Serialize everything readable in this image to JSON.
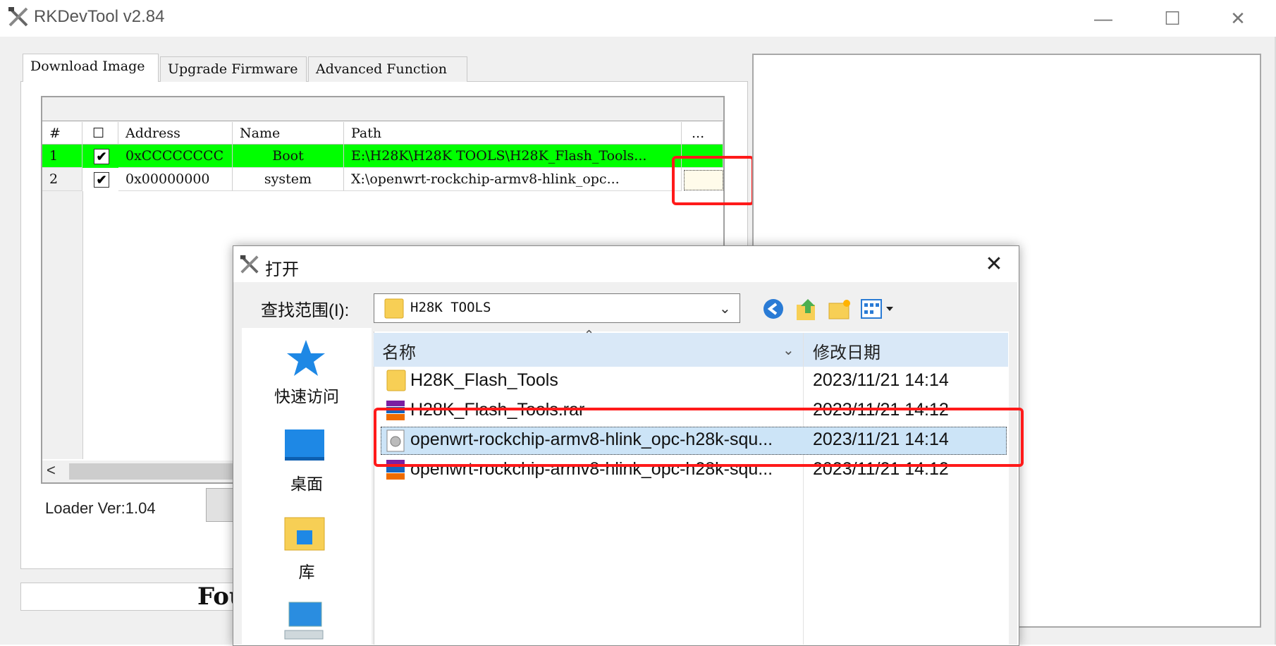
{
  "app": {
    "title": "RKDevTool v2.84",
    "minimize": "—",
    "maximize": "☐",
    "close": "✕"
  },
  "tabs": [
    "Download Image",
    "Upgrade Firmware",
    "Advanced Function"
  ],
  "grid": {
    "headers": [
      "#",
      "☐",
      "Address",
      "Name",
      "Path",
      "..."
    ],
    "rows": [
      {
        "num": "1",
        "checked": "✔",
        "address": "0xCCCCCCCC",
        "name": "Boot",
        "path": "E:\\H28K\\H28K TOOLS\\H28K_Flash_Tools..."
      },
      {
        "num": "2",
        "checked": "✔",
        "address": "0x00000000",
        "name": "system",
        "path": "X:\\openwrt-rockchip-armv8-hlink_opc..."
      }
    ],
    "row_highlight": "#00ff00",
    "scroll_left": "<"
  },
  "loader": "Loader Ver:1.04",
  "status_text": "Fou",
  "dialog": {
    "title": "打开",
    "close": "✕",
    "lookin_label": "查找范围(I):",
    "lookin_value": "H28K TOOLS",
    "places": [
      "快速访问",
      "桌面",
      "库"
    ],
    "columns": {
      "name": "名称",
      "date": "修改日期"
    },
    "files": [
      {
        "name": "H28K_Flash_Tools",
        "date": "2023/11/21 14:14",
        "icon": "folder-icon"
      },
      {
        "name": "H28K_Flash_Tools.rar",
        "date": "2023/11/21 14:12",
        "icon": "rar-archive-icon"
      },
      {
        "name": "openwrt-rockchip-armv8-hlink_opc-h28k-squ...",
        "date": "2023/11/21 14:14",
        "icon": "disc-image-file-icon"
      },
      {
        "name": "openwrt-rockchip-armv8-hlink_opc-h28k-squ...",
        "date": "2023/11/21 14:12",
        "icon": "rar-archive-icon"
      }
    ]
  },
  "colors": {
    "highlight_red": "#ff1a1a",
    "selection_blue": "#cce4f7",
    "header_blue": "#d9e8f7"
  }
}
